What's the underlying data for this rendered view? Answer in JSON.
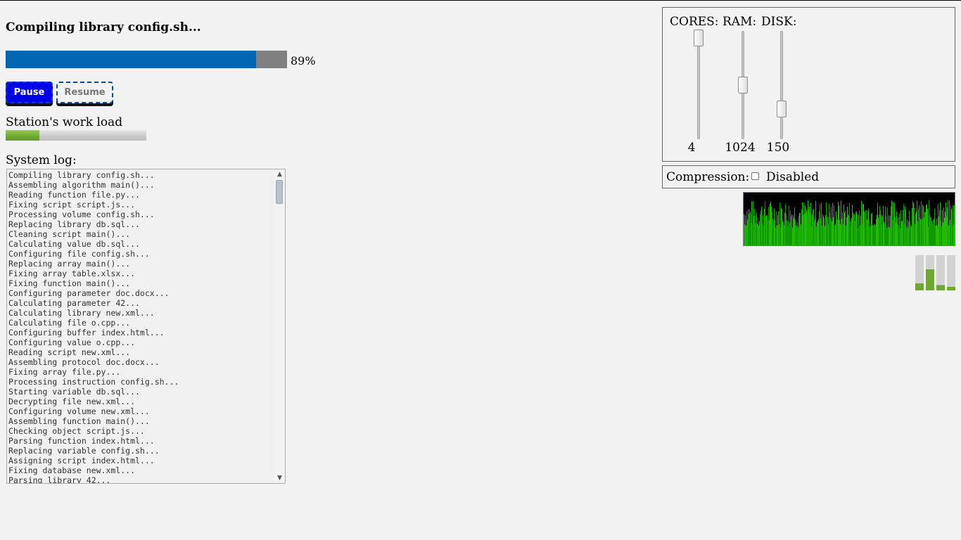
{
  "task": {
    "title": "Compiling library config.sh...",
    "progress": 0.89,
    "progress_label": "89%"
  },
  "buttons": {
    "pause_label": "Pause",
    "resume_label": "Resume"
  },
  "workload": {
    "label": "Station's work load",
    "level": 0.24
  },
  "log": {
    "label": "System log:",
    "lines": [
      "Compiling library config.sh...",
      "Assembling algorithm main()...",
      "Reading function file.py...",
      "Fixing script script.js...",
      "Processing volume config.sh...",
      "Replacing library db.sql...",
      "Cleaning script main()...",
      "Calculating value db.sql...",
      "Configuring file config.sh...",
      "Replacing array main()...",
      "Fixing array table.xlsx...",
      "Fixing function main()...",
      "Configuring parameter doc.docx...",
      "Calculating parameter 42...",
      "Calculating library new.xml...",
      "Calculating file o.cpp...",
      "Configuring buffer index.html...",
      "Configuring value o.cpp...",
      "Reading script new.xml...",
      "Assembling protocol doc.docx...",
      "Fixing array file.py...",
      "Processing instruction config.sh...",
      "Starting variable db.sql...",
      "Decrypting file new.xml...",
      "Configuring volume new.xml...",
      "Assembling function main()...",
      "Checking object script.js...",
      "Parsing function index.html...",
      "Replacing variable config.sh...",
      "Assigning script index.html...",
      "Fixing database new.xml...",
      "Parsing library 42..."
    ]
  },
  "resources": {
    "cores": {
      "label": "CORES:",
      "value": "4",
      "level": 1.0
    },
    "ram": {
      "label": "RAM:",
      "value": "1024",
      "level": 0.5
    },
    "disk": {
      "label": "DISK:",
      "value": "150",
      "level": 0.25
    }
  },
  "compression": {
    "label": "Compression:",
    "state_label": "Disabled",
    "checked": false
  },
  "colors": {
    "progress_fill": "#0066b3",
    "progress_track": "#808080",
    "pause_bg": "#0000e6",
    "graph_green": "#22bb00",
    "workload_green": "#6da832"
  },
  "mini_bars": [
    0.2,
    0.6,
    0.15,
    0.1
  ]
}
